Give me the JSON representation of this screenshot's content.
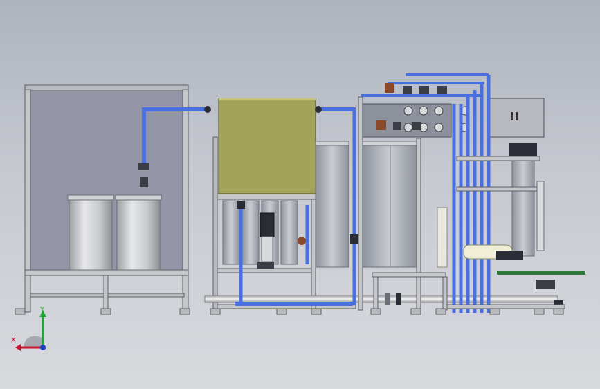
{
  "viewport": {
    "background_top": "#aeb3bd",
    "background_bottom": "#d8dade"
  },
  "triad": {
    "x_label": "X",
    "y_label": "Y",
    "x_color": "#c8102e",
    "y_color": "#1aa832",
    "z_color": "#1f3fbf"
  },
  "colors": {
    "pipe": "#4a6fe0",
    "frame": "#8a8d93",
    "hopper": "#a3a35a",
    "tank": "#c9cbce",
    "enclosure": "#9496a8",
    "valve": "#8a4a2a"
  }
}
